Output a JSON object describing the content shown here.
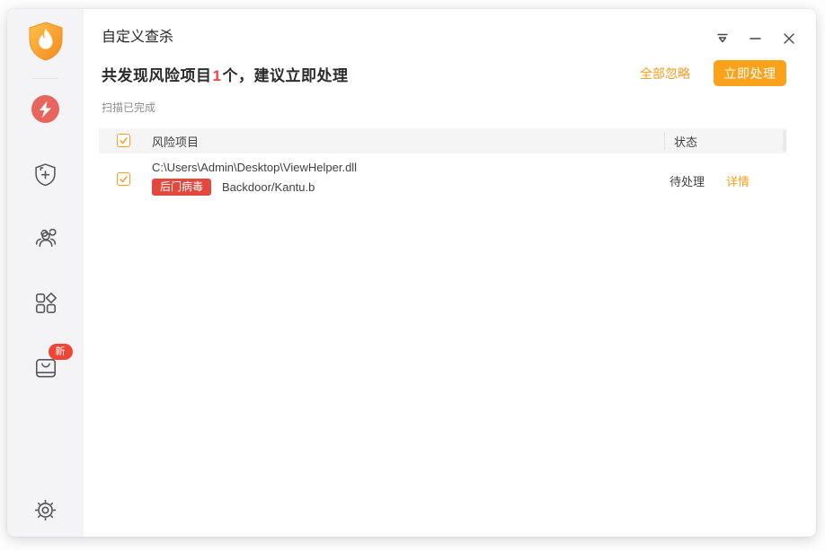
{
  "window": {
    "title": "自定义查杀",
    "controls": {
      "tray": "hide-to-tray-icon",
      "minimize": "minimize-icon",
      "close": "close-icon"
    }
  },
  "colors": {
    "accent_orange": "#faa21b",
    "link_orange": "#fa9d1c",
    "count_red": "#f5413b",
    "badge_red": "#e2483d",
    "scan_circle_red": "#e8655e",
    "new_badge_red": "#ef4537",
    "sidebar_bg": "#f4f4f6",
    "table_header_bg": "#f5f5f6"
  },
  "sidebar": {
    "items": [
      {
        "icon": "brand-shield-flame-logo"
      },
      {
        "icon": "virus-scan-lightning-icon"
      },
      {
        "icon": "shield-plus-icon"
      },
      {
        "icon": "users-icon"
      },
      {
        "icon": "toolbox-grid-icon"
      },
      {
        "icon": "upgrade-box-icon",
        "badge": "新"
      },
      {
        "icon": "settings-gear-icon"
      }
    ]
  },
  "summary": {
    "prefix": "共发现风险项目",
    "count": "1",
    "suffix": "个，建议立即处理",
    "ignore_all_label": "全部忽略",
    "handle_now_label": "立即处理"
  },
  "scan_status": "扫描已完成",
  "table": {
    "columns": [
      "风险项目",
      "状态"
    ],
    "rows": [
      {
        "path": "C:\\Users\\Admin\\Desktop\\ViewHelper.dll",
        "threat_type": "后门病毒",
        "threat_name": "Backdoor/Kantu.b",
        "status": "待处理",
        "detail_label": "详情",
        "checked": true
      }
    ]
  }
}
